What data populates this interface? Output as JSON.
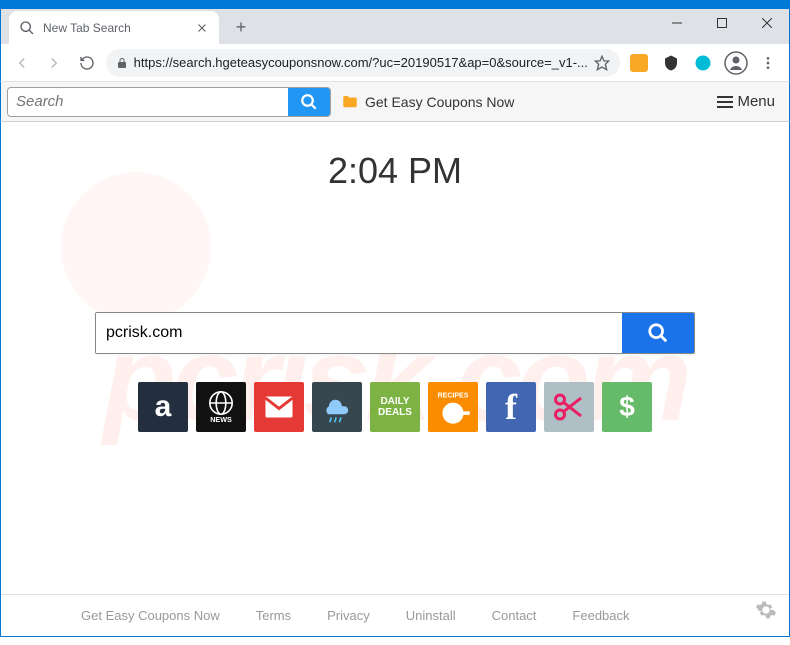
{
  "window": {
    "tab_title": "New Tab Search"
  },
  "address_bar": {
    "url": "https://search.hgeteasycouponsnow.com/?uc=20190517&ap=0&source=_v1-..."
  },
  "extension": {
    "search_placeholder": "Search",
    "brand_label": "Get Easy Coupons Now",
    "menu_label": "Menu"
  },
  "page": {
    "clock": "2:04 PM",
    "search_value": "pcrisk.com",
    "tiles": [
      {
        "name": "amazon",
        "label": "a"
      },
      {
        "name": "news",
        "label": "NEWS"
      },
      {
        "name": "gmail",
        "label": "M"
      },
      {
        "name": "weather",
        "label": ""
      },
      {
        "name": "deals",
        "label": "DAILY DEALS"
      },
      {
        "name": "recipes",
        "label": "RECIPES"
      },
      {
        "name": "facebook",
        "label": "f"
      },
      {
        "name": "scissors",
        "label": ""
      },
      {
        "name": "dollar",
        "label": "$"
      }
    ]
  },
  "footer": {
    "brand": "Get Easy Coupons Now",
    "terms": "Terms",
    "privacy": "Privacy",
    "uninstall": "Uninstall",
    "contact": "Contact",
    "feedback": "Feedback"
  },
  "watermark": "pcrisk.com"
}
